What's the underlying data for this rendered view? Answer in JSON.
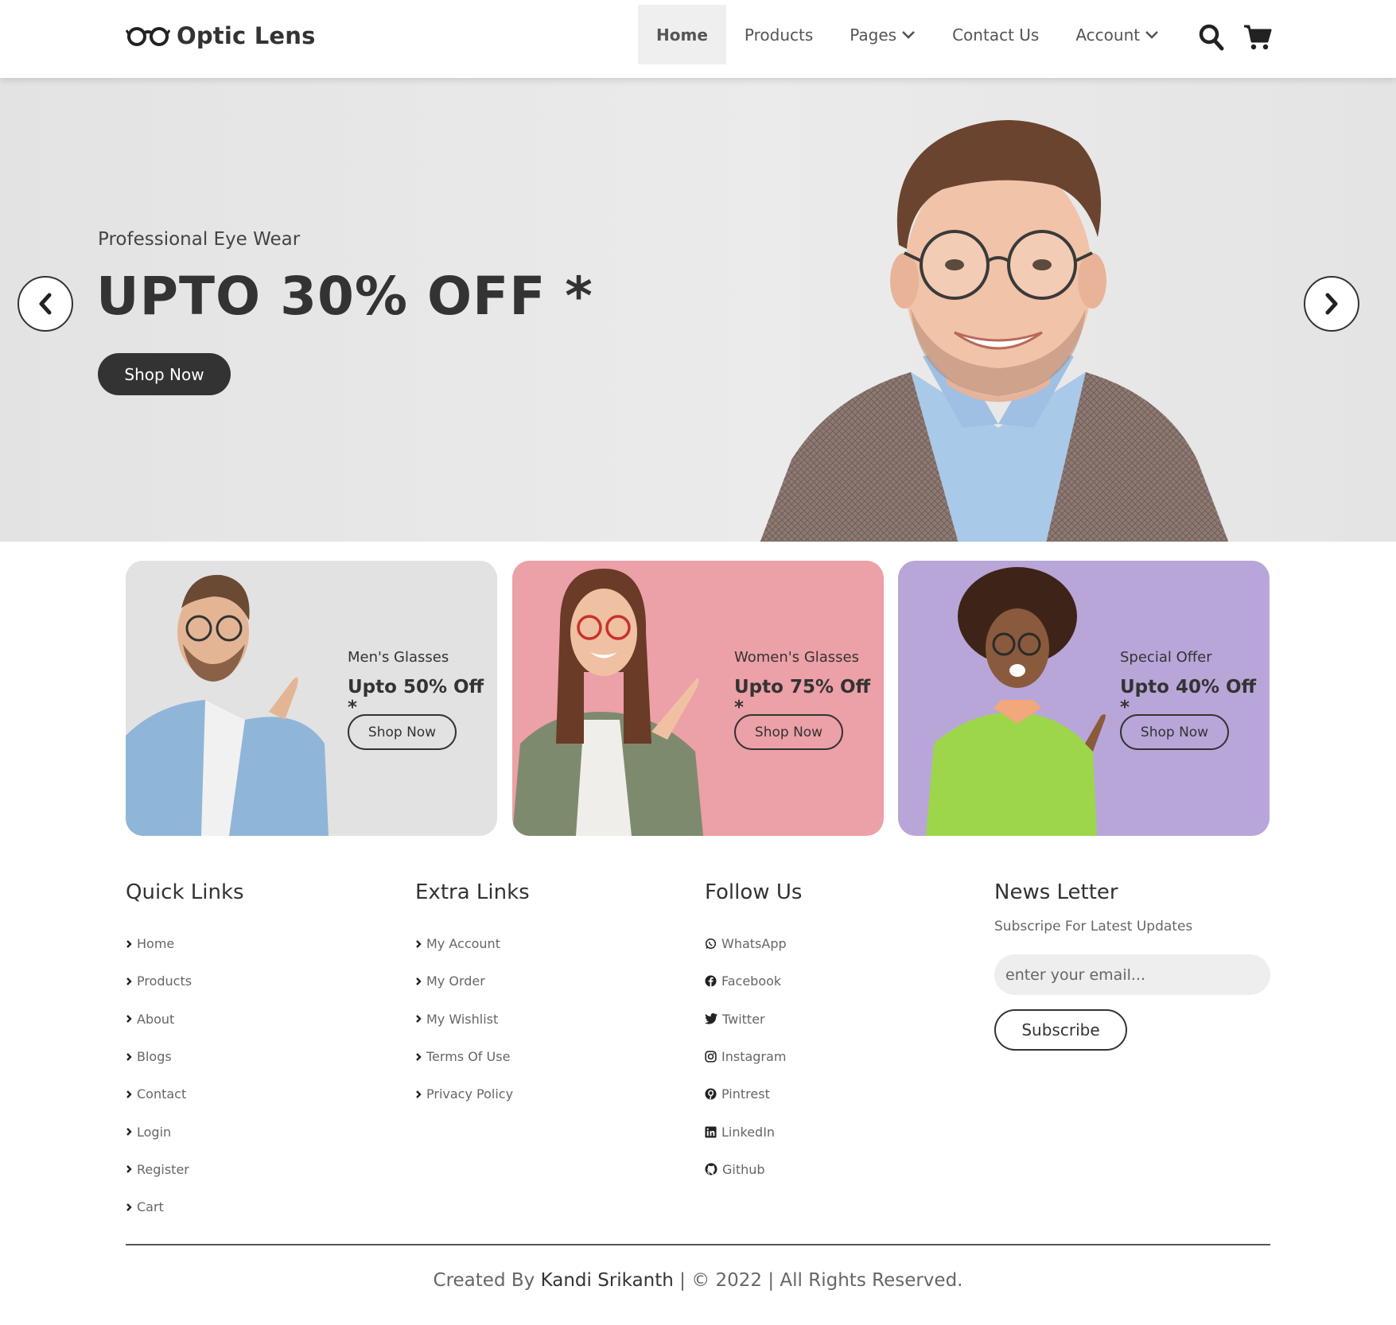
{
  "header": {
    "brand": "Optic Lens",
    "nav": [
      {
        "label": "Home",
        "active": true
      },
      {
        "label": "Products"
      },
      {
        "label": "Pages",
        "dropdown": true
      },
      {
        "label": "Contact Us"
      },
      {
        "label": "Account",
        "dropdown": true
      }
    ],
    "icons": [
      "search-icon",
      "cart-icon"
    ]
  },
  "hero": {
    "subtitle": "Professional Eye Wear",
    "title": "UPTO 30% OFF *",
    "button": "Shop Now"
  },
  "cards": [
    {
      "category": "Men's Glasses",
      "offer": "Upto 50% Off *",
      "button": "Shop Now",
      "bg": "#e2e2e2"
    },
    {
      "category": "Women's Glasses",
      "offer": "Upto 75% Off *",
      "button": "Shop Now",
      "bg": "#eca0a7"
    },
    {
      "category": "Special Offer",
      "offer": "Upto 40% Off *",
      "button": "Shop Now",
      "bg": "#b8a6d9"
    }
  ],
  "footer": {
    "quick_links": {
      "title": "Quick Links",
      "items": [
        "Home",
        "Products",
        "About",
        "Blogs",
        "Contact",
        "Login",
        "Register",
        "Cart"
      ]
    },
    "extra_links": {
      "title": "Extra Links",
      "items": [
        "My Account",
        "My Order",
        "My Wishlist",
        "Terms Of Use",
        "Privacy Policy"
      ]
    },
    "follow_us": {
      "title": "Follow Us",
      "items": [
        "WhatsApp",
        "Facebook",
        "Twitter",
        "Instagram",
        "Pintrest",
        "LinkedIn",
        "Github"
      ]
    },
    "newsletter": {
      "title": "News Letter",
      "subtitle": "Subscripe For Latest Updates",
      "placeholder": "enter your email...",
      "button": "Subscribe"
    },
    "credits": {
      "prefix": "Created By",
      "author": "Kandi Srikanth",
      "suffix": "| © 2022 | All Rights Reserved."
    }
  },
  "colors": {
    "text_dark": "#333333",
    "text_muted": "#666666",
    "nav_active_bg": "#efefef",
    "hero_bg": "#e8e8e8"
  }
}
